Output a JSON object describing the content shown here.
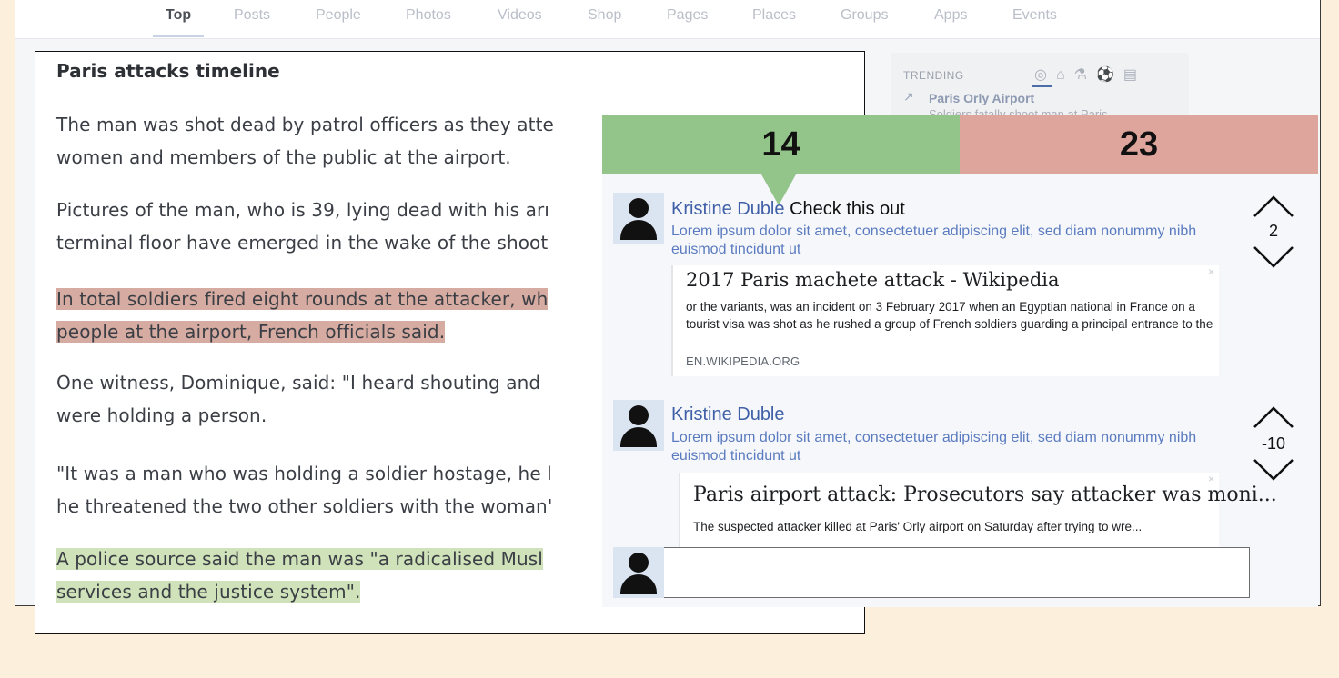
{
  "tabs": [
    {
      "label": "Top",
      "active": true
    },
    {
      "label": "Posts"
    },
    {
      "label": "People"
    },
    {
      "label": "Photos"
    },
    {
      "label": "Videos"
    },
    {
      "label": "Shop"
    },
    {
      "label": "Pages"
    },
    {
      "label": "Places"
    },
    {
      "label": "Groups"
    },
    {
      "label": "Apps"
    },
    {
      "label": "Events"
    }
  ],
  "article": {
    "title": "Paris attacks timeline",
    "paragraphs": [
      [
        "The man was shot dead by patrol officers as they atte",
        "women and members of the public at the airport."
      ],
      [
        "Pictures of the man, who is 39, lying dead with his arı",
        "terminal floor have emerged in the wake of the shoot"
      ],
      [
        "In total soldiers fired eight rounds at the attacker, wh",
        "people at the airport, French officials said."
      ],
      [
        "One witness, Dominique, said: \"I heard shouting and",
        "were holding a person."
      ],
      [
        "\"It was a man who was holding a soldier hostage, he l",
        "he threatened the two other soldiers with the woman'"
      ],
      [
        "A police source said the man was \"a radicalised Musl",
        "services and the justice system\"."
      ]
    ],
    "highlight_colors": {
      "red": "#d6aba1",
      "green": "#cfe2b9"
    }
  },
  "trending": {
    "label": "TRENDING",
    "icons": [
      "trending-circle-icon",
      "institution-icon",
      "flask-icon",
      "soccer-icon",
      "film-icon"
    ],
    "topic": "Paris Orly Airport",
    "description": "Soldiers fatally shoot man at Paris..."
  },
  "scores": {
    "agree": "14",
    "disagree": "23",
    "agree_color": "#93c58b",
    "disagree_color": "#dda59b"
  },
  "comments": [
    {
      "author": "Kristine Duble",
      "message": "Check this out",
      "text": "Lorem ipsum dolor sit amet, consectetuer adipiscing elit, sed diam nonummy nibh euismod tincidunt ut",
      "link": {
        "title": "2017 Paris machete attack - Wikipedia",
        "snippet": "or the variants, was an incident on 3 February 2017 when an Egyptian national in France on a tourist visa was shot as he rushed a group of French soldiers guarding a principal entrance to the",
        "source": "EN.WIKIPEDIA.ORG"
      },
      "votes": "2"
    },
    {
      "author": "Kristine Duble",
      "message": "",
      "text": "Lorem ipsum dolor sit amet, consectetuer adipiscing elit, sed diam nonummy nibh euismod tincidunt ut",
      "link": {
        "title": "Paris airport attack: Prosecutors say attacker was moni...",
        "snippet": "The suspected attacker killed at Paris' Orly airport on Saturday after trying to wre..."
      },
      "votes": "-10"
    }
  ],
  "composer": {
    "placeholder": ""
  }
}
